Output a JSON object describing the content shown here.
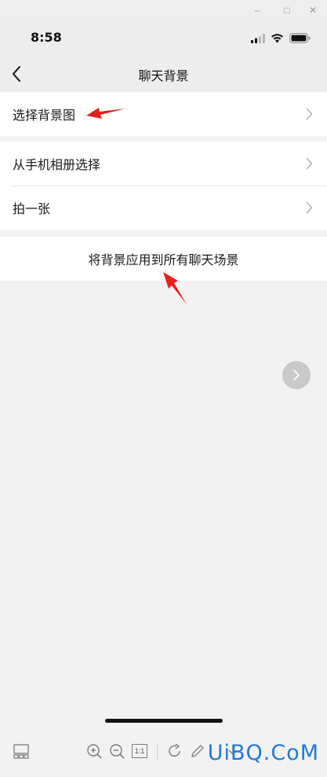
{
  "window": {
    "min_glyph": "–",
    "max_glyph": "□",
    "close_glyph": "✕"
  },
  "status": {
    "time": "8:58"
  },
  "nav": {
    "title": "聊天背景"
  },
  "cells": {
    "choose_bg": "选择背景图",
    "from_album": "从手机相册选择",
    "take_photo": "拍一张",
    "apply_all": "将背景应用到所有聊天场景"
  },
  "viewer_toolbar": {
    "actual_size_label": "1:1"
  },
  "watermark": "UiBQ.CoM",
  "colors": {
    "annotation_arrow": "#e8211c",
    "watermark": "#1f7ad6"
  }
}
